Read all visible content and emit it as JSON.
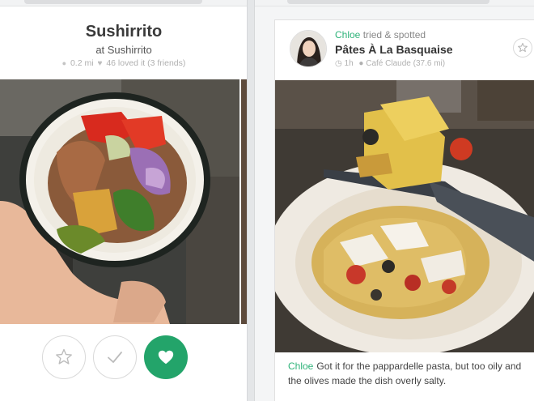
{
  "left_card": {
    "place_title": "Sushirrito",
    "place_subtitle": "at Sushirrito",
    "distance": "0.2 mi",
    "loved": "46 loved it (3 friends)",
    "actions": {
      "star_icon": "star-outline",
      "check_icon": "checkmark",
      "love_icon": "heart-filled"
    }
  },
  "right_card": {
    "user": "Chloe",
    "action_text": "tried & spotted",
    "dish_name": "Pâtes À La Basquaise",
    "time": "1h",
    "location": "Café Claude (37.6 mi)",
    "comment_user": "Chloe",
    "comment_text": "Got it for the pappardelle pasta, but too oily and the olives made the dish overly salty."
  },
  "colors": {
    "accent_green": "#23a46a",
    "username_green": "#2fb37a"
  }
}
